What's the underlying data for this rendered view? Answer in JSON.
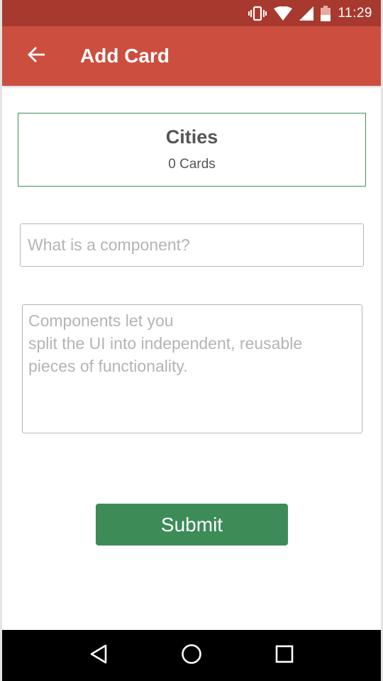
{
  "status_bar": {
    "time": "11:29",
    "icons": [
      "vibrate-icon",
      "wifi-icon",
      "signal-icon",
      "battery-icon"
    ]
  },
  "app_bar": {
    "title": "Add Card",
    "back_icon": "arrow-back-icon",
    "color": "#cc4e3f",
    "status_color": "#a8392e"
  },
  "deck": {
    "title": "Cities",
    "card_count": "0 Cards",
    "border_color": "#3f8d5a"
  },
  "form": {
    "question_placeholder": "What is a component?",
    "question_value": "",
    "answer_placeholder": "Components let you\nsplit the UI into independent, reusable\npieces of functionality.",
    "answer_value": "",
    "submit_label": "Submit",
    "submit_color": "#3d8c58"
  },
  "nav_bar": {
    "icons": [
      "back-triangle-icon",
      "home-circle-icon",
      "recents-square-icon"
    ]
  }
}
